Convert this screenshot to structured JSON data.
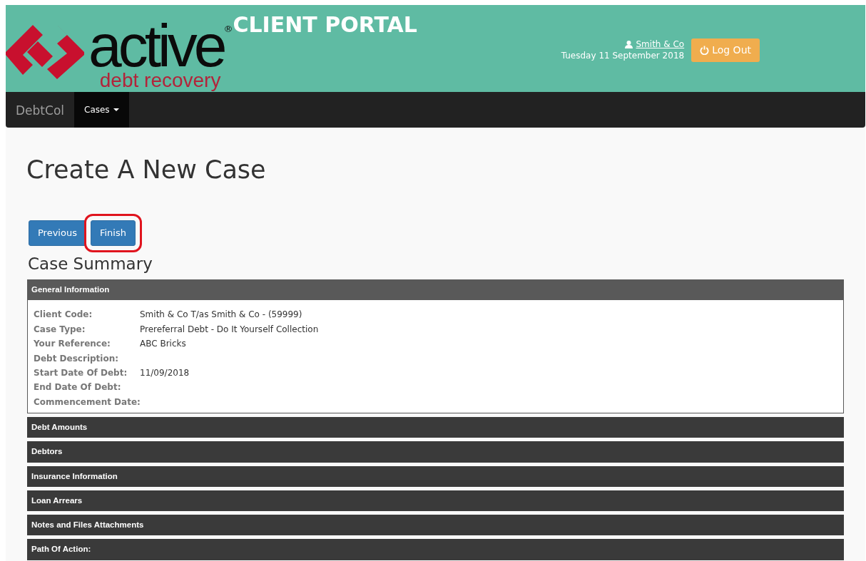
{
  "header": {
    "logo_word": "active",
    "logo_sub": "debt recovery",
    "logo_mark": "®",
    "portal_title": "CLIENT PORTAL",
    "user_link": "Smith & Co",
    "date": "Tuesday 11 September 2018",
    "logout_button": "Log Out"
  },
  "navbar": {
    "brand": "DebtCol",
    "items": [
      {
        "label": "Cases",
        "selected": true,
        "dropdown": true
      }
    ]
  },
  "page_title": "Create A New Case",
  "buttons": [
    {
      "label": "Previous",
      "highlighted": false
    },
    {
      "label": "Finish",
      "highlighted": true
    }
  ],
  "summary_title": "Case Summary",
  "sections": [
    {
      "title": "General Information",
      "expanded": true,
      "fields": [
        {
          "label": "Client Code:",
          "value": "Smith & Co T/as Smith & Co - (59999)"
        },
        {
          "label": "Case Type:",
          "value": "Prereferral Debt - Do It Yourself Collection"
        },
        {
          "label": "Your Reference:",
          "value": "ABC Bricks"
        },
        {
          "label": "Debt Description:"
        },
        {
          "label": "Start Date Of Debt:",
          "value": "11/09/2018"
        },
        {
          "label": "End Date Of Debt:"
        },
        {
          "label": "Commencement Date:"
        }
      ]
    },
    {
      "title": "Debt Amounts",
      "expanded": false
    },
    {
      "title": "Debtors",
      "expanded": false
    },
    {
      "title": "Insurance Information",
      "expanded": false
    },
    {
      "title": "Loan Arrears",
      "expanded": false
    },
    {
      "title": "Notes and Files Attachments",
      "expanded": false
    },
    {
      "title": "Path Of Action:",
      "expanded": false
    }
  ]
}
